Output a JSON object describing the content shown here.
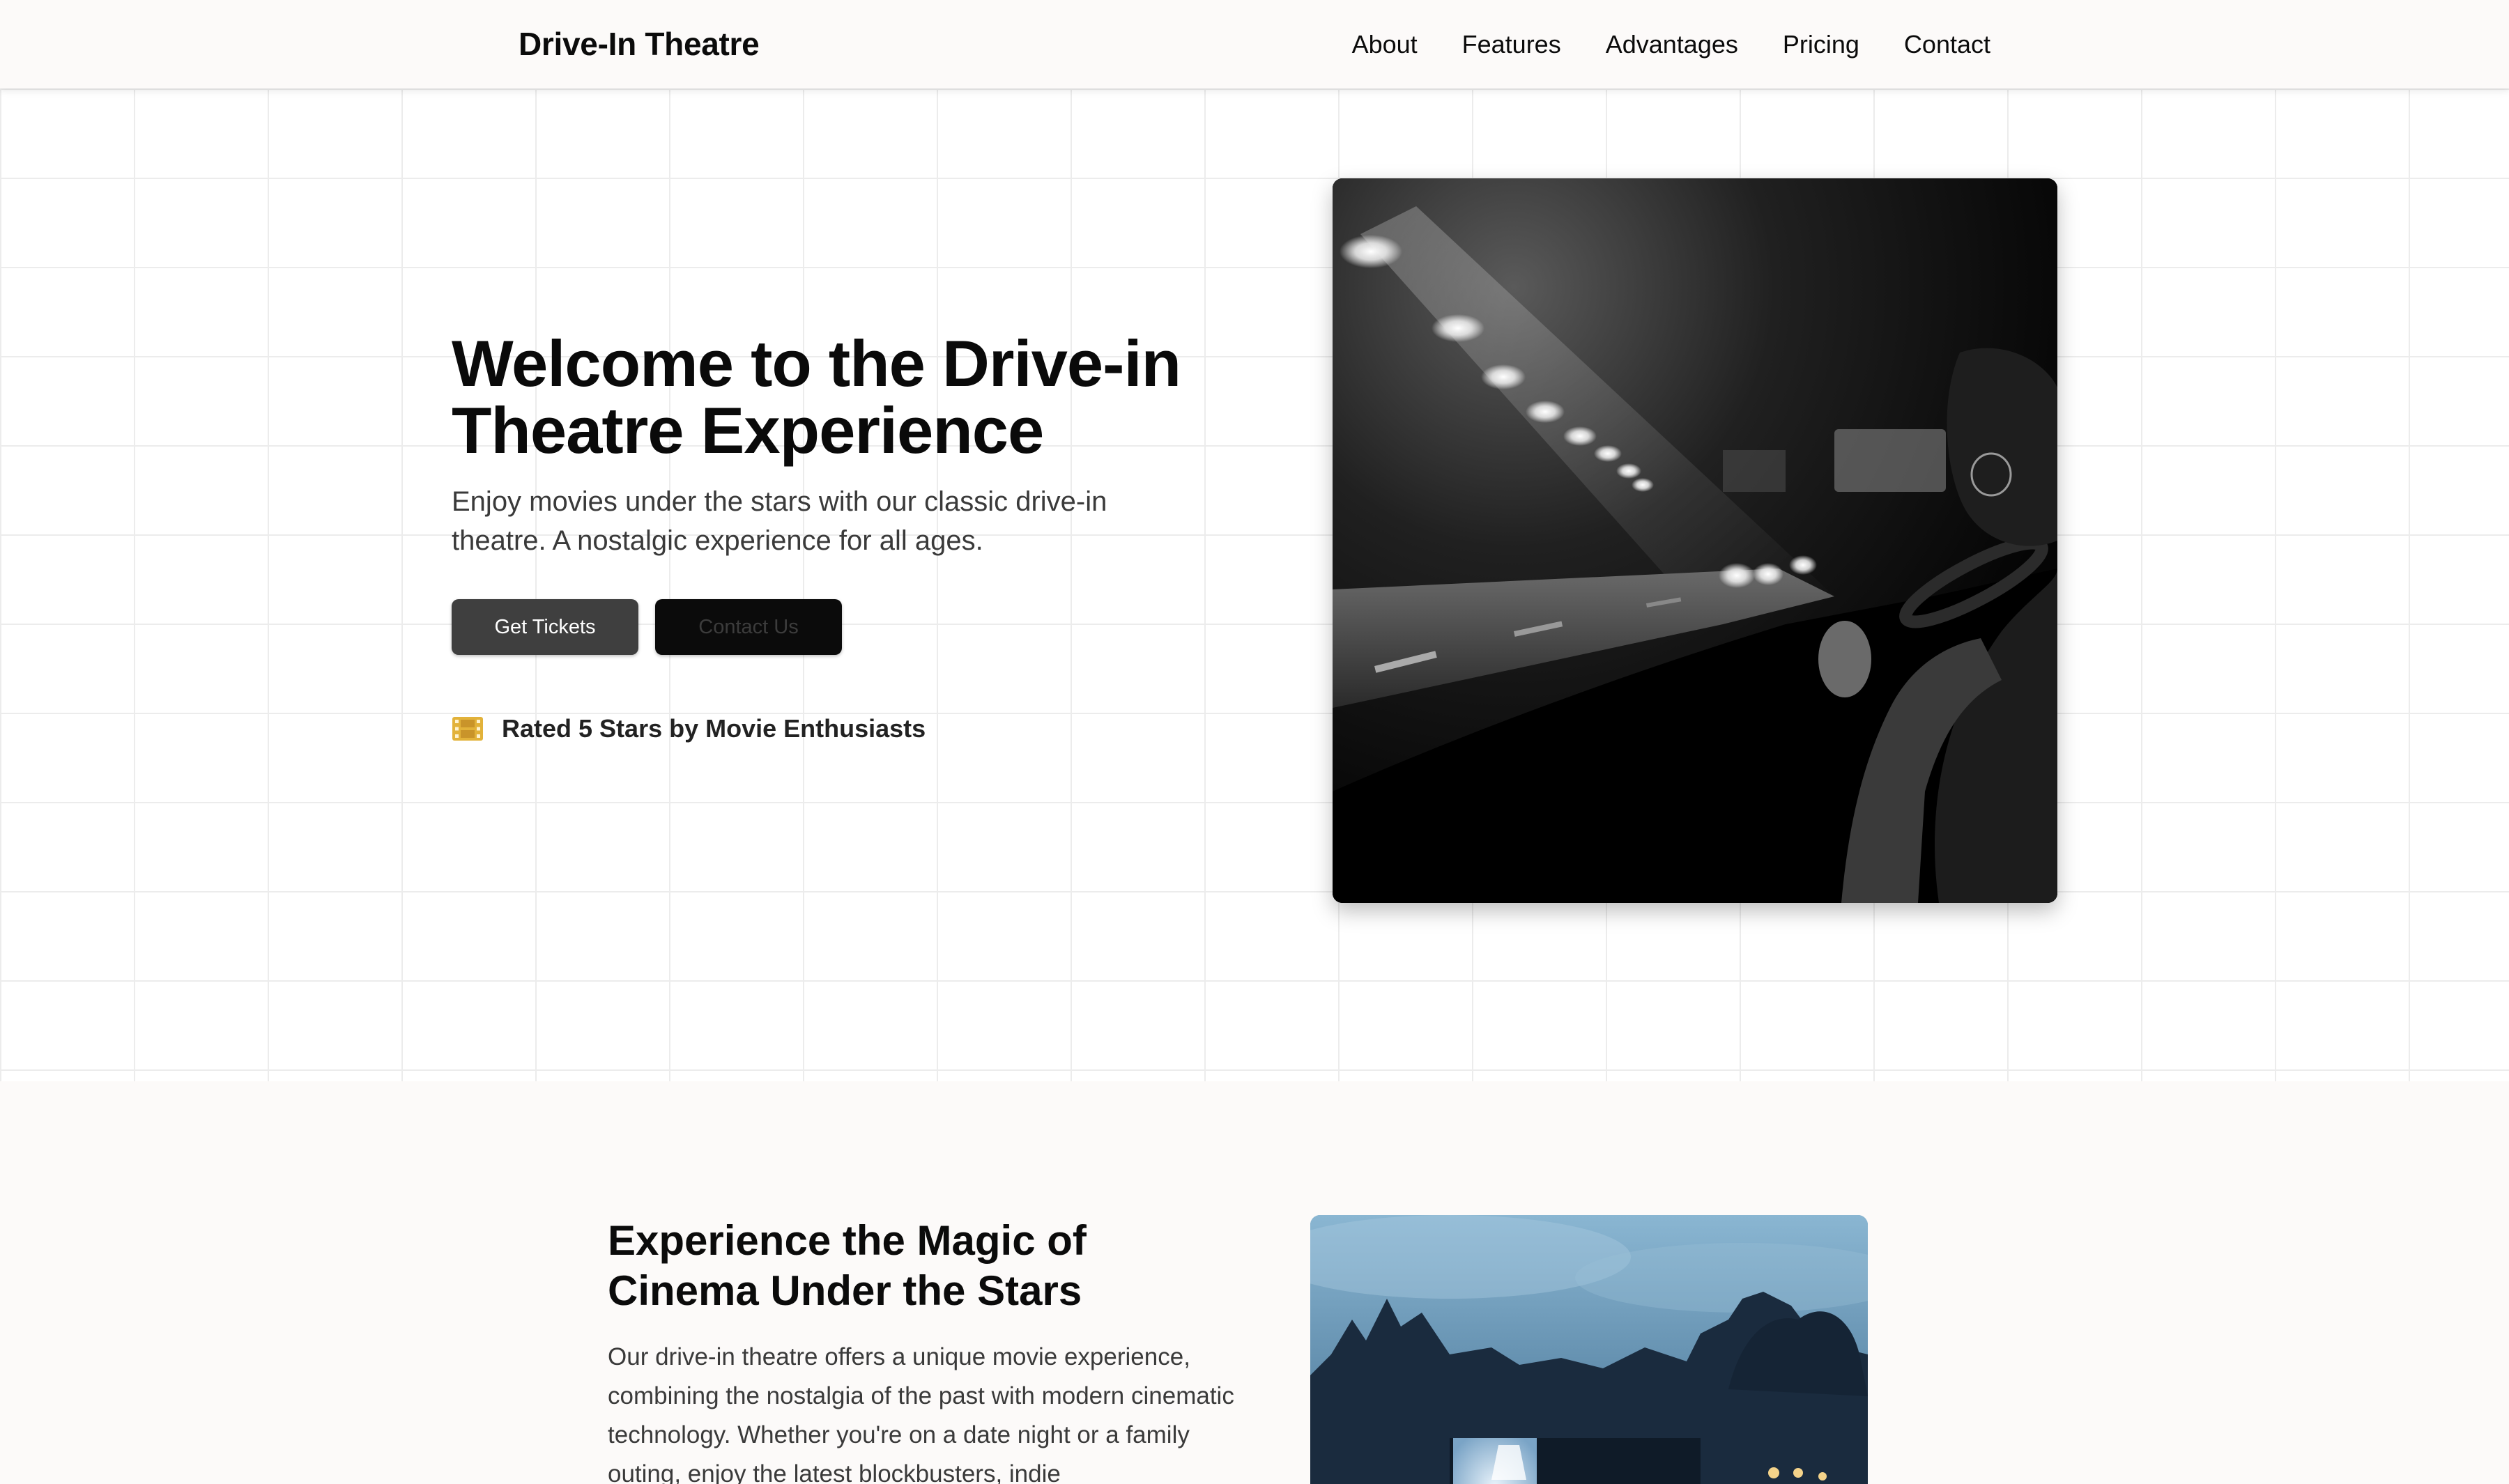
{
  "navbar": {
    "brand": "Drive-In Theatre",
    "links": [
      "About",
      "Features",
      "Advantages",
      "Pricing",
      "Contact"
    ]
  },
  "hero": {
    "title": "Welcome to the Drive-in Theatre Experience",
    "subtitle": "Enjoy movies under the stars with our classic drive-in theatre. A nostalgic experience for all ages.",
    "primary_button": "Get Tickets",
    "secondary_button": "Contact Us",
    "rating_icon": "film-icon",
    "rating_text": "Rated 5 Stars by Movie Enthusiasts"
  },
  "section2": {
    "title": "Experience the Magic of Cinema Under the Stars",
    "body": "Our drive-in theatre offers a unique movie experience, combining the nostalgia of the past with modern cinematic technology. Whether you're on a date night or a family outing, enjoy the latest blockbusters, indie"
  },
  "colors": {
    "nav_bg": "#fcfaf9",
    "primary_button": "#3f3f3f",
    "secondary_button": "#0b0b0b",
    "icon_accent": "#e2b23a",
    "grid_line": "#ececec"
  }
}
